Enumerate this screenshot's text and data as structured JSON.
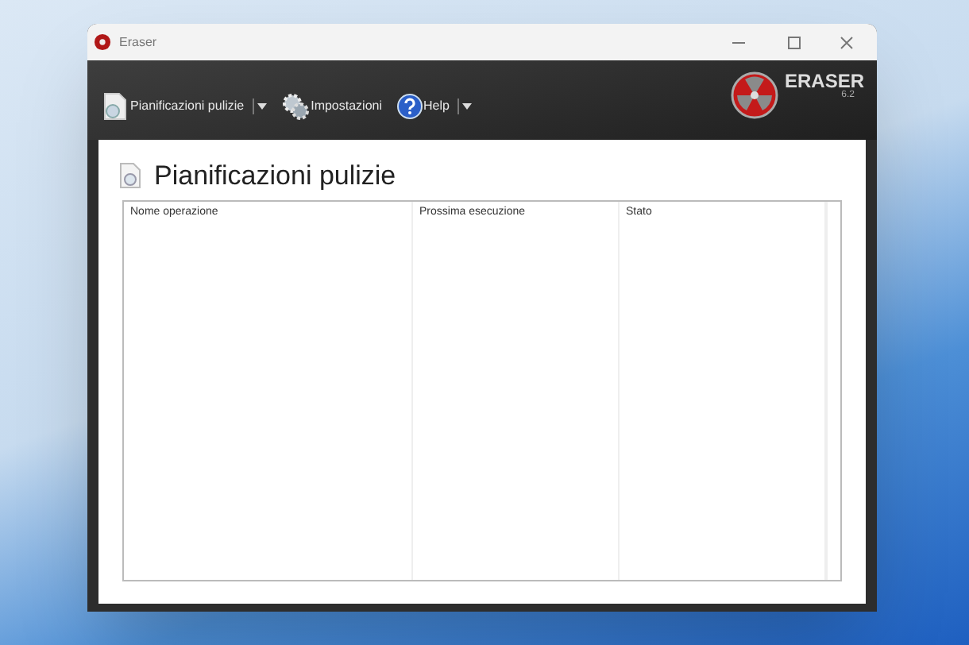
{
  "window": {
    "title": "Eraser"
  },
  "toolbar": [
    {
      "label": "Pianificazioni pulizie",
      "kind": "schedule",
      "dropdown": true
    },
    {
      "label": "Impostazioni",
      "kind": "settings",
      "dropdown": false
    },
    {
      "label": "Help",
      "kind": "help",
      "dropdown": true
    }
  ],
  "logo": {
    "name": "ERASER",
    "version": "6.2"
  },
  "page": {
    "title": "Pianificazioni pulizie"
  },
  "table": {
    "columns": [
      "Nome operazione",
      "Prossima esecuzione",
      "Stato"
    ]
  }
}
